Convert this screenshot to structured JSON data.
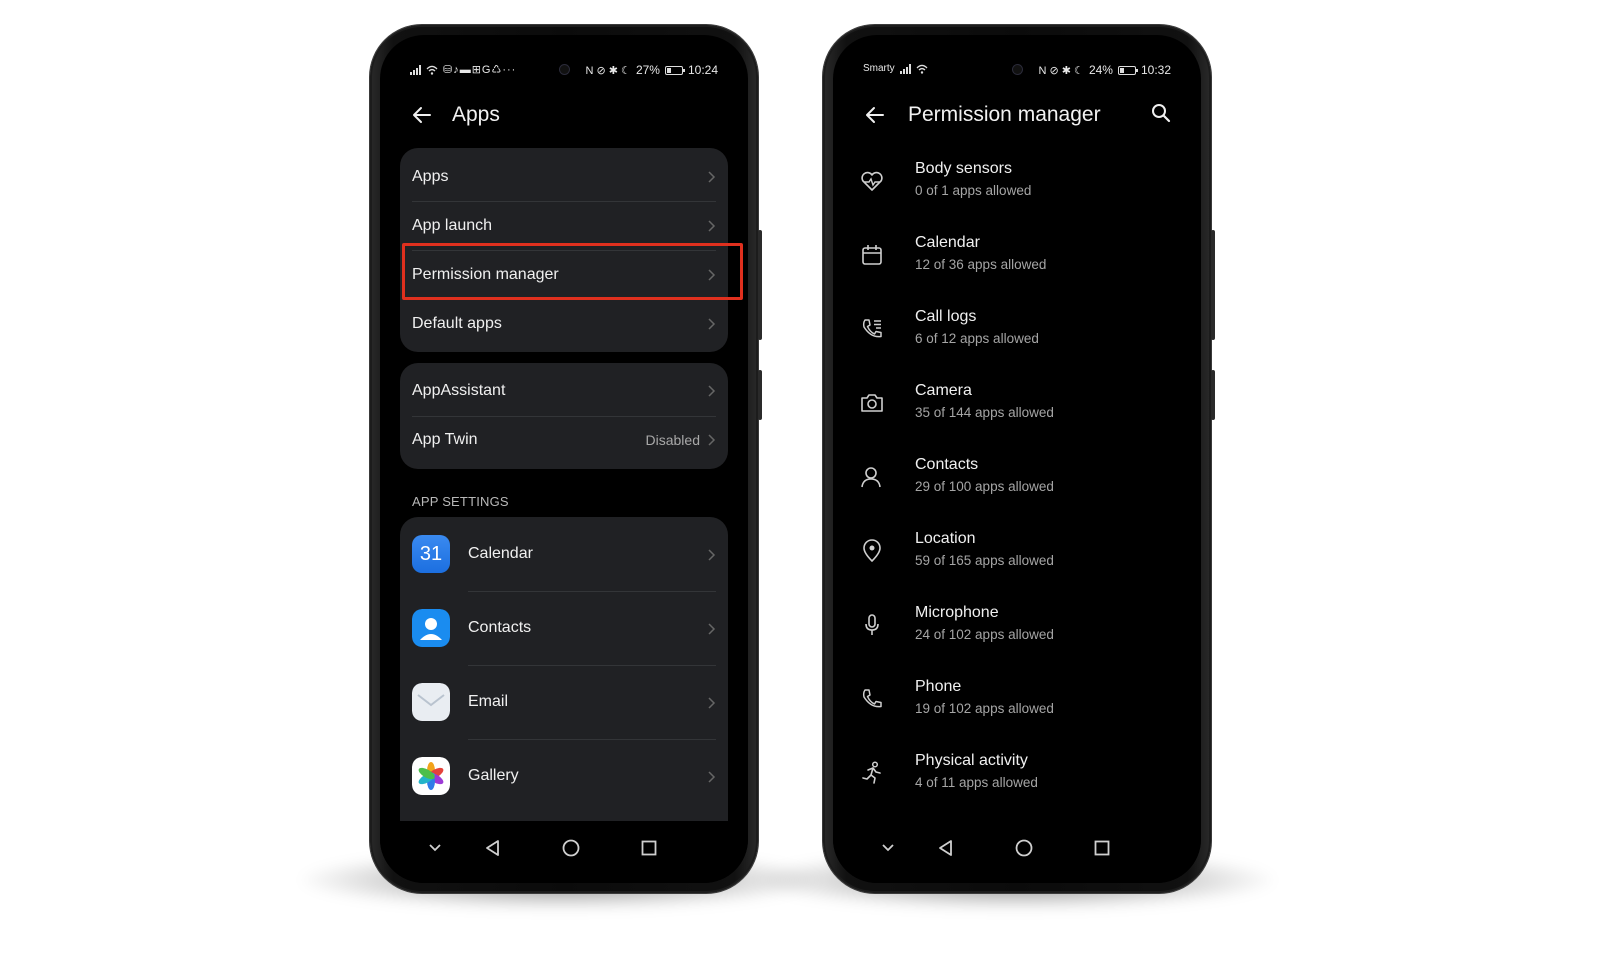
{
  "left_phone": {
    "status": {
      "icons": [
        "signal-icon",
        "wifi-icon",
        "notification-icons"
      ],
      "indicators": "N ⊘ ✱ ☾",
      "battery": "27%",
      "time": "10:24"
    },
    "header": {
      "title": "Apps"
    },
    "group1": [
      {
        "label": "Apps"
      },
      {
        "label": "App launch"
      },
      {
        "label": "Permission manager",
        "highlighted": true
      },
      {
        "label": "Default apps"
      }
    ],
    "group2": [
      {
        "label": "AppAssistant",
        "value": ""
      },
      {
        "label": "App Twin",
        "value": "Disabled"
      }
    ],
    "section_label": "APP SETTINGS",
    "app_settings": [
      {
        "label": "Calendar",
        "icon": "calendar-app-icon",
        "icon_text": "31"
      },
      {
        "label": "Contacts",
        "icon": "contacts-app-icon"
      },
      {
        "label": "Email",
        "icon": "email-app-icon"
      },
      {
        "label": "Gallery",
        "icon": "gallery-app-icon"
      }
    ],
    "highlight_color": "#e0301e"
  },
  "right_phone": {
    "status": {
      "carrier": "Smarty",
      "indicators": "N ⊘ ✱ ☾",
      "battery": "24%",
      "time": "10:32"
    },
    "header": {
      "title": "Permission manager"
    },
    "permissions": [
      {
        "title": "Body sensors",
        "subtitle": "0 of 1 apps allowed",
        "icon": "heart-rate-icon"
      },
      {
        "title": "Calendar",
        "subtitle": "12 of 36 apps allowed",
        "icon": "calendar-icon"
      },
      {
        "title": "Call logs",
        "subtitle": "6 of 12 apps allowed",
        "icon": "call-log-icon"
      },
      {
        "title": "Camera",
        "subtitle": "35 of 144 apps allowed",
        "icon": "camera-icon"
      },
      {
        "title": "Contacts",
        "subtitle": "29 of 100 apps allowed",
        "icon": "contact-person-icon"
      },
      {
        "title": "Location",
        "subtitle": "59 of 165 apps allowed",
        "icon": "location-pin-icon"
      },
      {
        "title": "Microphone",
        "subtitle": "24 of 102 apps allowed",
        "icon": "microphone-icon"
      },
      {
        "title": "Phone",
        "subtitle": "19 of 102 apps allowed",
        "icon": "phone-icon"
      },
      {
        "title": "Physical activity",
        "subtitle": "4 of 11 apps allowed",
        "icon": "running-person-icon"
      }
    ]
  },
  "navbar": {
    "icons": [
      "collapse-chevron-icon",
      "back-triangle-icon",
      "home-circle-icon",
      "recents-square-icon"
    ]
  }
}
